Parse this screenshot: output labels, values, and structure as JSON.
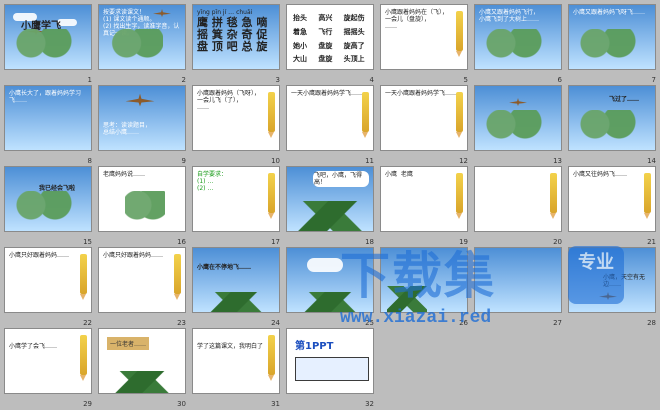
{
  "slides": [
    {
      "n": "1",
      "title": "小鹰学飞"
    },
    {
      "n": "2",
      "text": "按要求读课文！\n(1) 课文读个通顺。\n(2) 找出生字，读准字音，认真记一读。"
    },
    {
      "n": "3",
      "chars": "鹰 拼 毯 急 嘀 摇 箕 杂 奇 促 盘 顶 吧 总 旋",
      "pinyin": "yīng pīn jí … chuāi"
    },
    {
      "n": "4",
      "words": [
        "抬头",
        "高兴",
        "旋起伤",
        "着急",
        "飞行",
        "摇摇头",
        "她小",
        "盘旋",
        "旋高了",
        "大山",
        "盘旋",
        "头顶上"
      ]
    },
    {
      "n": "5",
      "text": "小鹰跟着妈妈在（飞），\n一会儿（盘旋），\n……"
    },
    {
      "n": "6",
      "text": "小鹰又跟着妈妈飞行，\n小鹰飞到了大树上……"
    },
    {
      "n": "7",
      "text": "小鹰又跟着妈妈飞呀飞……"
    },
    {
      "n": "8",
      "text": "小鹰长大了，跟着妈妈学习飞……"
    },
    {
      "n": "9",
      "text": "思考：读读题目，\n总结小鹰……"
    },
    {
      "n": "10",
      "text": "小鹰跟着妈妈（飞呀），\n一会儿飞（了），\n……"
    },
    {
      "n": "11",
      "text": "一天小鹰跟着妈妈学飞……"
    },
    {
      "n": "12",
      "text": "一天小鹰跟着妈妈学飞……"
    },
    {
      "n": "13",
      "text": ""
    },
    {
      "n": "14",
      "text": "飞过了……"
    },
    {
      "n": "15",
      "text": "我已经会飞啦"
    },
    {
      "n": "16",
      "text": "老鹰妈妈说……"
    },
    {
      "n": "17",
      "text": "自学要求：\n(1) …\n(2) …"
    },
    {
      "n": "18",
      "text": "飞吧，小鹰，飞得高！"
    },
    {
      "n": "19",
      "text": "小鹰  老鹰"
    },
    {
      "n": "20",
      "text": ""
    },
    {
      "n": "21",
      "text": "小鹰又往妈妈飞……"
    },
    {
      "n": "22",
      "text": "小鹰只好跟着妈妈……"
    },
    {
      "n": "23",
      "text": "小鹰只好跟着妈妈……"
    },
    {
      "n": "24",
      "text": "小鹰在不停地飞……"
    },
    {
      "n": "25",
      "text": ""
    },
    {
      "n": "26",
      "text": ""
    },
    {
      "n": "27",
      "text": ""
    },
    {
      "n": "28",
      "text": "小鹰，天空有无边……"
    },
    {
      "n": "29",
      "text": "小鹰学了会飞……"
    },
    {
      "n": "30",
      "text": "一位老者……"
    },
    {
      "n": "31",
      "text": "学了这篇课文，我明白了"
    },
    {
      "n": "32",
      "brand": "第1PPT"
    }
  ],
  "watermark": {
    "cn": "下载集",
    "pro": "专业",
    "url": "www.xiazai.red"
  }
}
